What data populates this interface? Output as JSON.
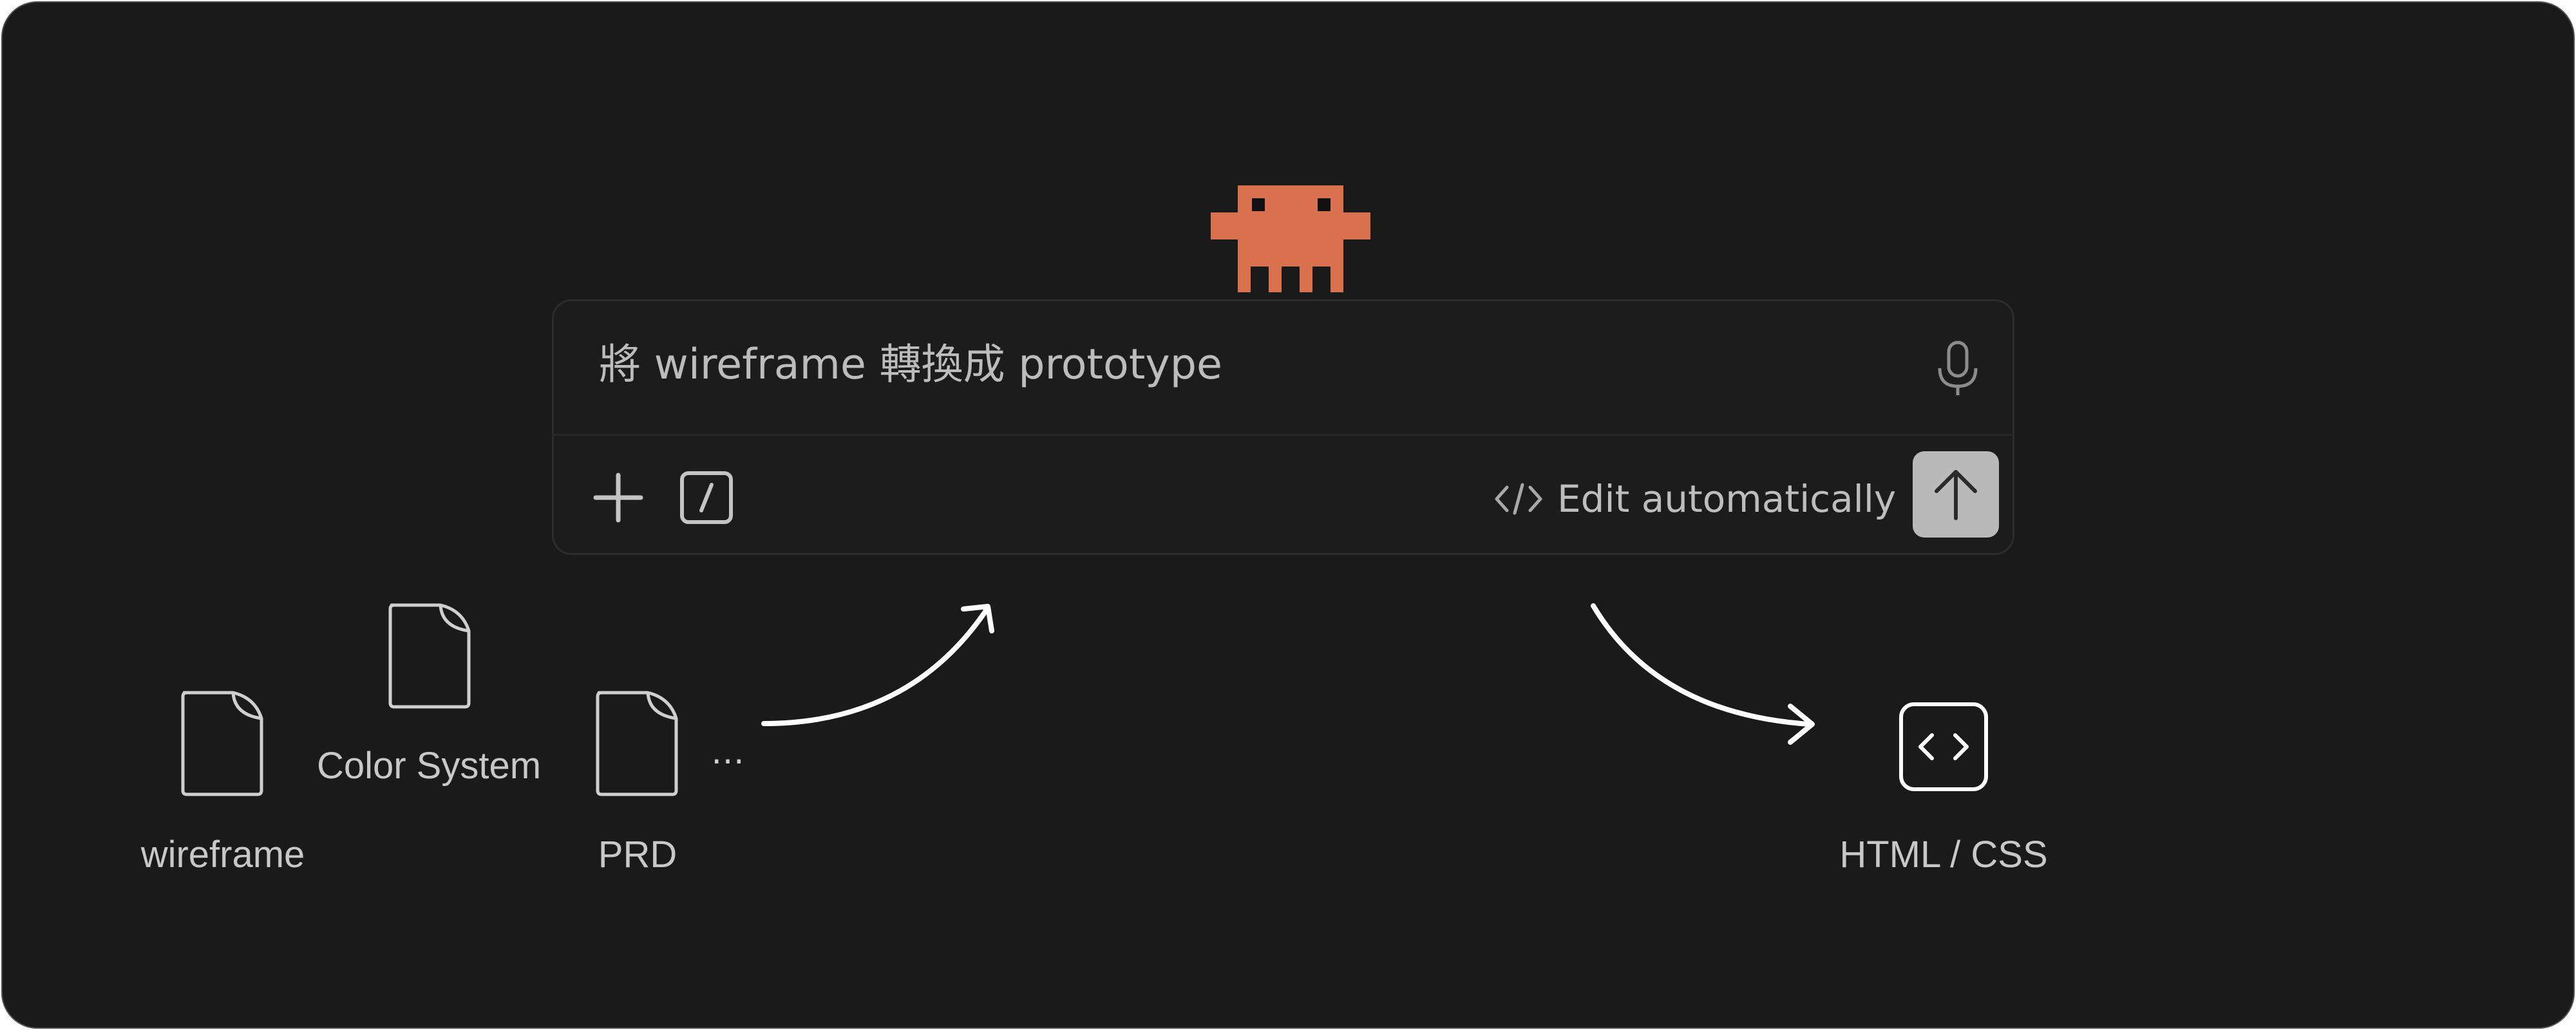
{
  "prompt": {
    "text": "將 wireframe 轉換成 prototype",
    "edit_mode_label": "Edit automatically"
  },
  "icons": {
    "mascot": "pixel-creature-icon",
    "mic": "microphone-icon",
    "add": "plus-icon",
    "commands": "slash-command-icon",
    "edit_mode": "code-brackets-icon",
    "send": "arrow-up-icon",
    "output": "code-file-icon"
  },
  "inputs": {
    "files": [
      "wireframe",
      "Color System",
      "PRD"
    ],
    "more": "…"
  },
  "output": {
    "label": "HTML / CSS"
  },
  "colors": {
    "background": "#1a1a1a",
    "mascot": "#d9714f",
    "send_button": "#b9b9b9",
    "text": "#bcbcbc"
  }
}
